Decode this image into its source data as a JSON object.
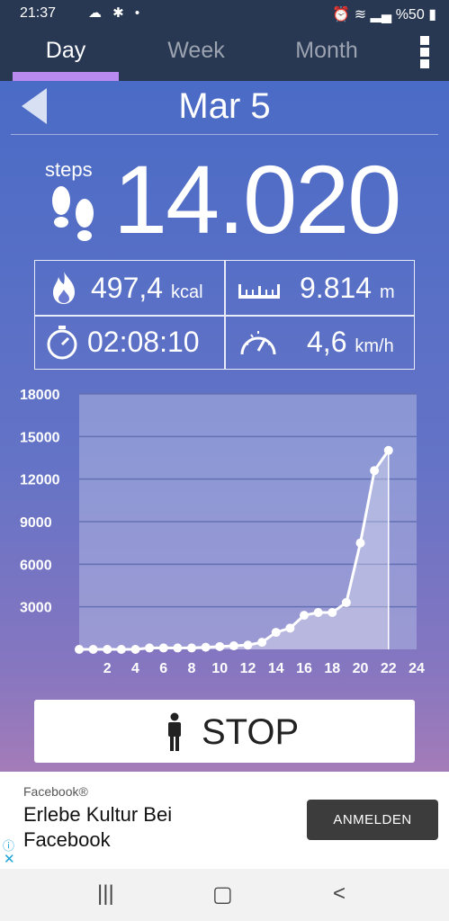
{
  "status_bar": {
    "time": "21:37",
    "battery": "%50"
  },
  "tabs": [
    {
      "label": "Day",
      "active": true
    },
    {
      "label": "Week",
      "active": false
    },
    {
      "label": "Month",
      "active": false
    }
  ],
  "header": {
    "date": "Mar 5"
  },
  "steps": {
    "label": "steps",
    "value": "14.020"
  },
  "stats": {
    "calories": {
      "value": "497,4",
      "unit": "kcal"
    },
    "distance": {
      "value": "9.814",
      "unit": "m"
    },
    "duration": {
      "value": "02:08:10"
    },
    "speed": {
      "value": "4,6",
      "unit": "km/h"
    }
  },
  "chart_data": {
    "type": "line",
    "title": "",
    "xlabel": "",
    "ylabel": "",
    "x_ticks": [
      2,
      4,
      6,
      8,
      10,
      12,
      14,
      16,
      18,
      20,
      22,
      24
    ],
    "y_ticks": [
      3000,
      6000,
      9000,
      12000,
      15000,
      18000
    ],
    "xlim": [
      0,
      24
    ],
    "ylim": [
      0,
      18000
    ],
    "grid": true,
    "x": [
      0,
      1,
      2,
      3,
      4,
      5,
      6,
      7,
      8,
      9,
      10,
      11,
      12,
      13,
      14,
      15,
      16,
      17,
      18,
      19,
      20,
      21,
      22
    ],
    "values": [
      0,
      0,
      0,
      0,
      0,
      100,
      100,
      100,
      100,
      150,
      200,
      250,
      300,
      500,
      1200,
      1500,
      2400,
      2600,
      2600,
      3300,
      7500,
      12600,
      14020
    ]
  },
  "stop_button": {
    "label": "STOP"
  },
  "ad": {
    "source": "Facebook®",
    "title": "Erlebe Kultur Bei Facebook",
    "button_label": "ANMELDEN",
    "info_glyph": "ⓘ",
    "close_glyph": "✕"
  },
  "nav": {
    "recents_glyph": "|||",
    "home_glyph": "▢",
    "back_glyph": "<"
  }
}
